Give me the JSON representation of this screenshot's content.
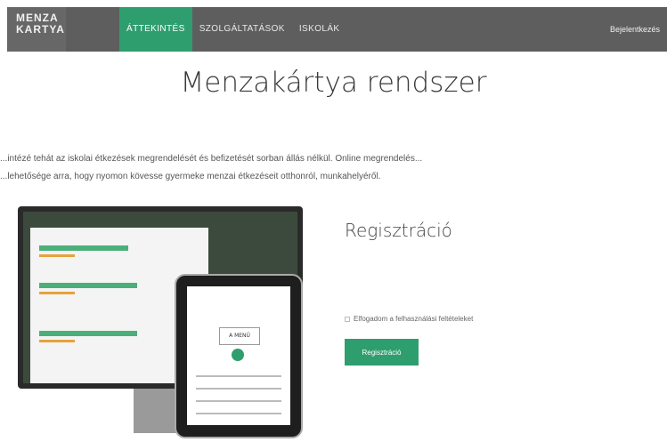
{
  "header": {
    "logo_line1": "MENZA",
    "logo_line2": "KARTYA",
    "nav": [
      {
        "label": "ÁTTEKINTÉS",
        "active": true
      },
      {
        "label": "SZOLGÁLTATÁSOK",
        "active": false
      },
      {
        "label": "ISKOLÁK",
        "active": false
      }
    ],
    "login": "Bejelentkezés"
  },
  "page": {
    "title": "Menzakártya rendszer",
    "intro_line1": "...intézé tehát az iskolai étkezések megrendelését és befizetését sorban állás nélkül. Online megrendelés...",
    "intro_line2": "...lehetősége arra, hogy nyomon kövesse gyermeke menzai étkezéseit otthonról, munkahelyéről."
  },
  "mockup": {
    "tablet_menu_label": "A MENÜ"
  },
  "registration": {
    "title": "Regisztráció",
    "terms_label": "Elfogadom a felhasználási feltételeket",
    "button_label": "Regisztráció"
  },
  "colors": {
    "accent": "#2f9e6e",
    "topbar": "#5e5e5e"
  }
}
